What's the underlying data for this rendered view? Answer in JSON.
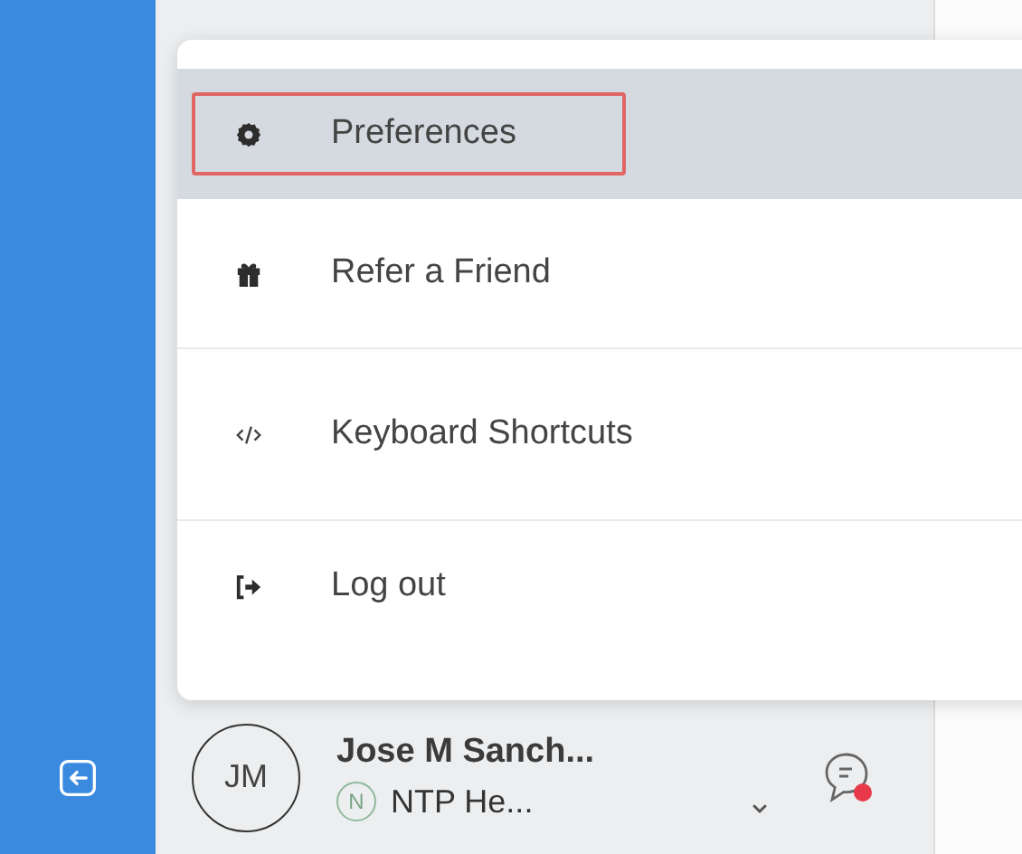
{
  "menu": {
    "items": [
      {
        "kind": "gear",
        "label": "Preferences",
        "selected": true
      },
      {
        "kind": "gift",
        "label": "Refer a Friend",
        "selected": false
      },
      {
        "kind": "code",
        "label": "Keyboard Shortcuts",
        "selected": false
      },
      {
        "kind": "logout",
        "label": "Log out",
        "selected": false
      }
    ]
  },
  "user": {
    "initials": "JM",
    "name": "Jose M Sanch...",
    "org_badge": "N",
    "org": "NTP He...",
    "unread": true
  }
}
